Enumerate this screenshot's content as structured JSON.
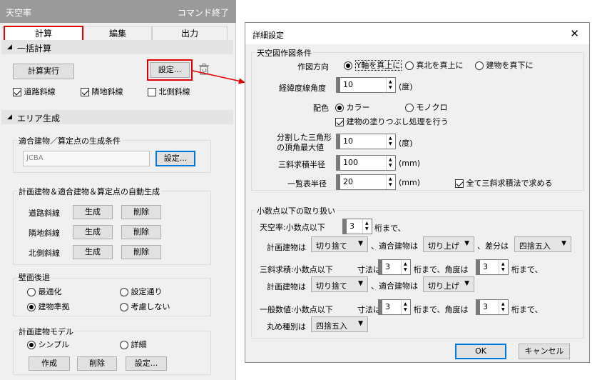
{
  "panel": {
    "title": "天空率",
    "end_command": "コマンド終了",
    "tabs": [
      "計算",
      "編集",
      "出力"
    ],
    "batch": {
      "header": "一括計算",
      "calc_button": "計算実行",
      "settings_button": "設定...",
      "checks": [
        {
          "label": "道路斜線",
          "checked": true
        },
        {
          "label": "隣地斜線",
          "checked": true
        },
        {
          "label": "北側斜線",
          "checked": false
        }
      ]
    },
    "area": {
      "header": "エリア生成",
      "cond_group": "適合建物／算定点の生成条件",
      "cond_value": "JCBA",
      "cond_settings": "設定...",
      "auto_group": "計画建物＆適合建物＆算定点の自動生成",
      "rows": [
        {
          "label": "道路斜線",
          "create": "生成",
          "delete": "削除"
        },
        {
          "label": "隣地斜線",
          "create": "生成",
          "delete": "削除"
        },
        {
          "label": "北側斜線",
          "create": "生成",
          "delete": "削除"
        }
      ],
      "wall_group": "壁面後退",
      "wall_options": [
        {
          "label": "最適化",
          "selected": false
        },
        {
          "label": "設定通り",
          "selected": false
        },
        {
          "label": "建物準拠",
          "selected": true
        },
        {
          "label": "考慮しない",
          "selected": false
        }
      ],
      "model_group": "計画建物モデル",
      "model_options": [
        {
          "label": "シンプル",
          "selected": true
        },
        {
          "label": "詳細",
          "selected": false
        }
      ],
      "model_buttons": [
        "作成",
        "削除",
        "設定..."
      ]
    }
  },
  "dialog": {
    "title": "詳細設定",
    "close": "✕",
    "g1": {
      "title": "天空図作図条件",
      "direction_label": "作図方向",
      "direction_options": [
        {
          "label": "Y軸を真上に",
          "selected": true
        },
        {
          "label": "真北を真上に",
          "selected": false
        },
        {
          "label": "建物を真下に",
          "selected": false
        }
      ],
      "latlong_label": "経緯度線角度",
      "latlong_value": "10",
      "latlong_unit": "(度)",
      "color_label": "配色",
      "color_options": [
        {
          "label": "カラー",
          "selected": true
        },
        {
          "label": "モノクロ",
          "selected": false
        }
      ],
      "fill_check": "建物の塗りつぶし処理を行う",
      "fill_checked": true,
      "tri_label_1": "分割した三角形",
      "tri_label_2": "の頂角最大値",
      "tri_value": "10",
      "tri_unit": "(度)",
      "r3_label": "三斜求積半径",
      "r3_value": "100",
      "r3_unit": "(mm)",
      "list_label": "一覧表半径",
      "list_value": "20",
      "list_unit": "(mm)",
      "all_check": "全て三斜求積法で求める",
      "all_checked": true
    },
    "g2": {
      "title": "小数点以下の取り扱い",
      "sky_label": "天空率:小数点以下",
      "sky_value": "3",
      "digits_suffix": "桁まで、",
      "plan_label": "計画建物は",
      "plan_value": "切り捨て",
      "fit_label": "、適合建物は",
      "fit_value": "切り上げ",
      "diff_label": "、差分は",
      "diff_value": "四捨五入",
      "tri_label": "三斜求積:小数点以下",
      "dims_label": "寸法は",
      "tri_dim_value": "3",
      "angle_label": "桁まで、角度は",
      "tri_angle_value": "3",
      "digits_suffix2": "桁まで、",
      "plan2_label": "計画建物は",
      "plan2_value": "切り捨て",
      "fit2_label": "、適合建物は",
      "fit2_value": "切り上げ",
      "gen_label": "一般数値:小数点以下",
      "dims2_label": "寸法は",
      "gen_dim_value": "3",
      "angle2_label": "桁まで、角度は",
      "gen_angle_value": "3",
      "digits_suffix3": "桁まで、",
      "round_label": "丸め種別は",
      "round_value": "四捨五入"
    },
    "ok": "OK",
    "cancel": "キャンセル"
  },
  "colors": {
    "highlight": "#e00000",
    "focus": "#0078d7",
    "title_gray": "#9a9a9a"
  }
}
